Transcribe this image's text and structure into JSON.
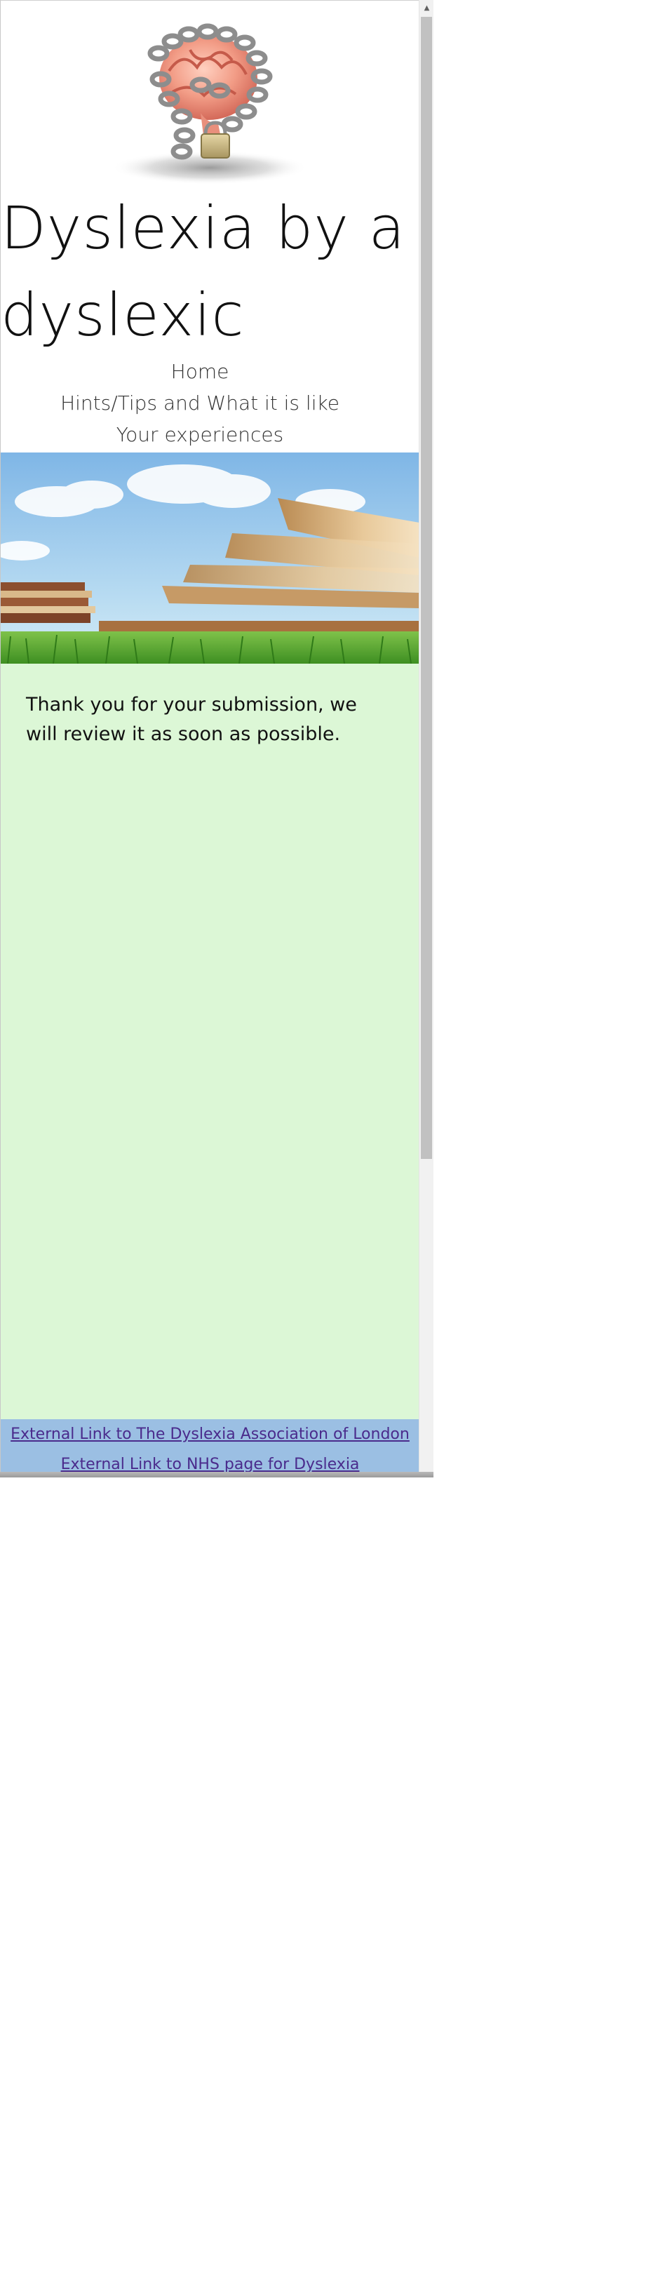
{
  "site": {
    "title": "Dyslexia by a dyslexic"
  },
  "logo": {
    "icon": "chained-brain-padlock-icon"
  },
  "nav": {
    "items": [
      {
        "label": "Home"
      },
      {
        "label": "Hints/Tips and What it is like"
      },
      {
        "label": "Your experiences"
      }
    ]
  },
  "banner": {
    "icon": "books-on-grass-image"
  },
  "main": {
    "message": "Thank you for your submission, we will review it as soon as possible."
  },
  "footer": {
    "links": [
      {
        "label": "External Link to The Dyslexia Association of London"
      },
      {
        "label": "External Link to NHS page for Dyslexia"
      }
    ]
  },
  "scrollbar": {
    "up_arrow": "▲"
  },
  "colors": {
    "content_background": "#dcf7d6",
    "footer_background": "#9bbfe3",
    "link_color": "#4a2b8c"
  }
}
